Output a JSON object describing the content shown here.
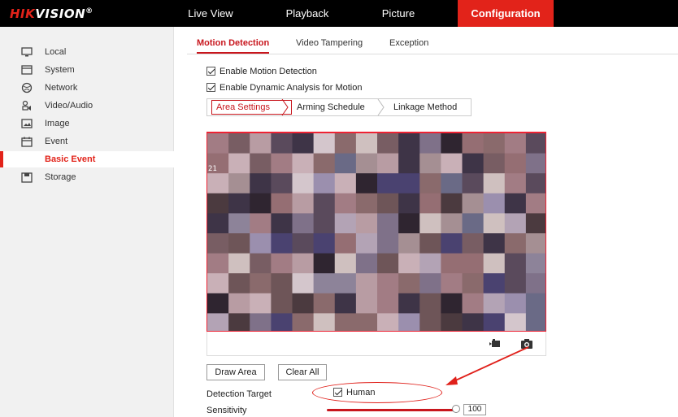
{
  "brand": {
    "logo_red": "HIK",
    "logo_white": "VISION",
    "logo_reg": "®"
  },
  "topnav": [
    "Live View",
    "Playback",
    "Picture",
    "Configuration"
  ],
  "topnav_active": "Configuration",
  "sidebar": {
    "items": [
      {
        "label": "Local",
        "icon": "monitor-icon"
      },
      {
        "label": "System",
        "icon": "window-icon"
      },
      {
        "label": "Network",
        "icon": "globe-icon"
      },
      {
        "label": "Video/Audio",
        "icon": "camera-mic-icon"
      },
      {
        "label": "Image",
        "icon": "image-icon"
      },
      {
        "label": "Event",
        "icon": "calendar-icon"
      },
      {
        "label": "Basic Event",
        "icon": "",
        "active": true
      },
      {
        "label": "Storage",
        "icon": "disk-icon"
      }
    ]
  },
  "tabs": [
    {
      "label": "Motion Detection",
      "active": true
    },
    {
      "label": "Video Tampering"
    },
    {
      "label": "Exception"
    }
  ],
  "options": {
    "enable_motion": "Enable Motion Detection",
    "enable_dynamic": "Enable Dynamic Analysis for Motion"
  },
  "subtabs": [
    {
      "label": "Area Settings",
      "active": true
    },
    {
      "label": "Arming Schedule"
    },
    {
      "label": "Linkage Method"
    }
  ],
  "video_overlay_digits": "21",
  "buttons": {
    "draw_area": "Draw Area",
    "clear_all": "Clear All"
  },
  "detection_target": {
    "label": "Detection Target",
    "value": "Human"
  },
  "sensitivity": {
    "label": "Sensitivity",
    "value": "100",
    "level": 1.0
  },
  "colors": {
    "accent": "#e2231a",
    "topbar": "#000000",
    "sidebar_bg": "#f1f1f1"
  }
}
